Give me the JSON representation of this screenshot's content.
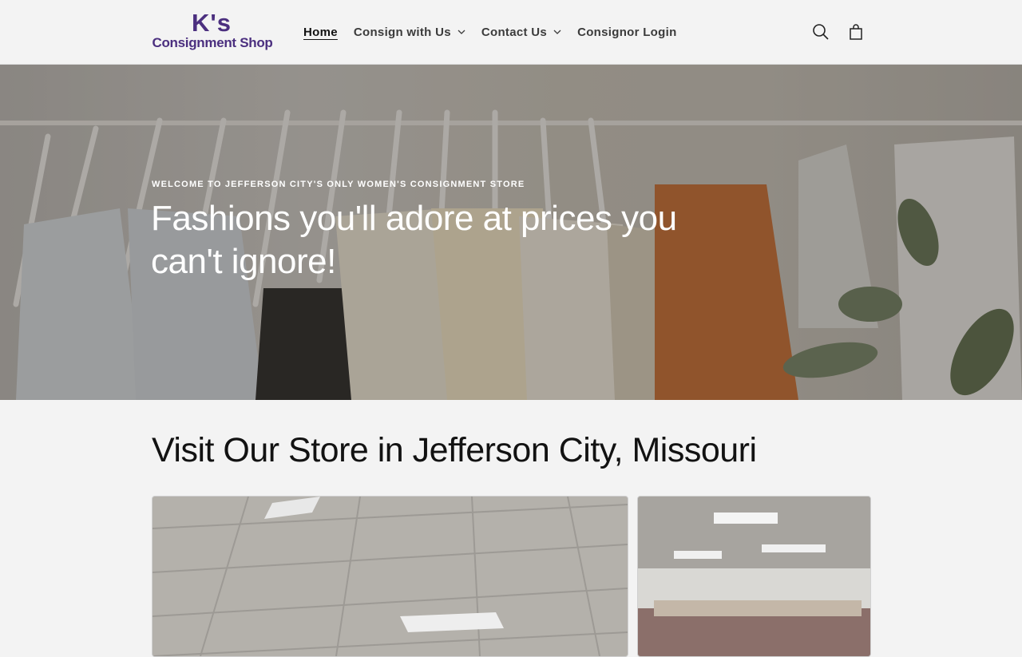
{
  "brand": {
    "logo_line1": "K's",
    "logo_line2": "Consignment Shop",
    "color": "#4b2f7f"
  },
  "nav": {
    "items": [
      {
        "label": "Home",
        "active": true,
        "dropdown": false
      },
      {
        "label": "Consign with Us",
        "active": false,
        "dropdown": true
      },
      {
        "label": "Contact Us",
        "active": false,
        "dropdown": true
      },
      {
        "label": "Consignor Login",
        "active": false,
        "dropdown": false
      }
    ]
  },
  "header_icons": {
    "search": "search-icon",
    "cart": "cart-icon"
  },
  "hero": {
    "eyebrow": "Welcome to Jefferson City's only women's consignment store",
    "headline": "Fashions you'll adore at prices you can't ignore!"
  },
  "section": {
    "title": "Visit Our Store in Jefferson City, Missouri"
  }
}
